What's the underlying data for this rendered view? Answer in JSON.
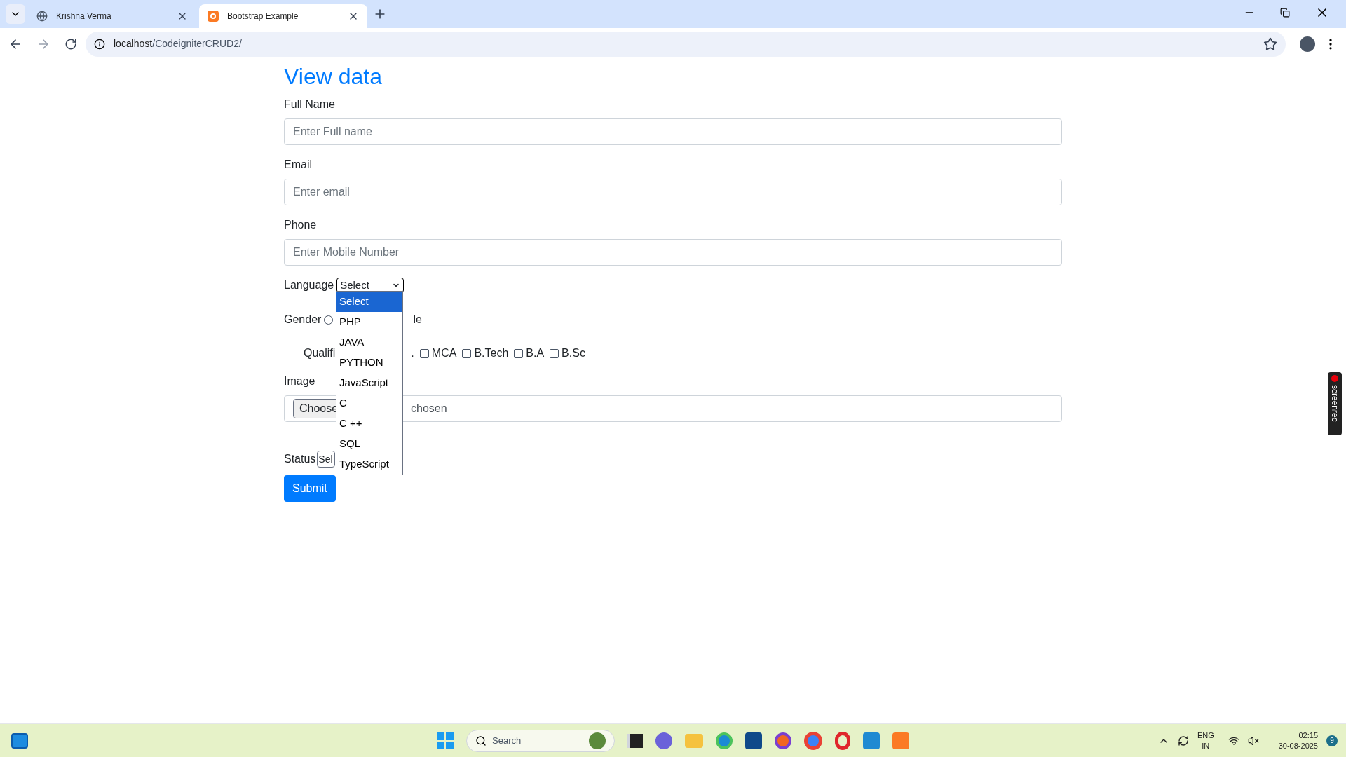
{
  "browser": {
    "tabs": [
      {
        "title": "Krishna Verma",
        "kind": "globe",
        "selected": false
      },
      {
        "title": "Bootstrap Example",
        "kind": "xampp",
        "selected": true
      }
    ],
    "url_host": "localhost",
    "url_path": "/CodeigniterCRUD2/"
  },
  "page": {
    "title": "View data",
    "fields": [
      {
        "label": "Full Name",
        "placeholder": "Enter Full name"
      },
      {
        "label": "Email",
        "placeholder": "Enter email"
      },
      {
        "label": "Phone",
        "placeholder": "Enter Mobile Number"
      }
    ],
    "language": {
      "label": "Language",
      "value": "Select",
      "expanded": true,
      "options": [
        {
          "label": "Select",
          "selected": true
        },
        {
          "label": "PHP",
          "selected": false
        },
        {
          "label": "JAVA",
          "selected": false
        },
        {
          "label": "PYTHON",
          "selected": false
        },
        {
          "label": "JavaScript",
          "selected": false
        },
        {
          "label": "C",
          "selected": false
        },
        {
          "label": "C ++",
          "selected": false
        },
        {
          "label": "SQL",
          "selected": false
        },
        {
          "label": "TypeScript",
          "selected": false
        }
      ]
    },
    "gender": {
      "label": "Gender",
      "checked": false,
      "trailing_text": "le"
    },
    "qualification": {
      "label": "Qualifi",
      "trailing_text": ".",
      "options": [
        {
          "label": "MCA",
          "checked": false
        },
        {
          "label": "B.Tech",
          "checked": false
        },
        {
          "label": "B.A",
          "checked": false
        },
        {
          "label": "B.Sc",
          "checked": false
        }
      ]
    },
    "image": {
      "label": "Image",
      "button": "Choose",
      "status": "chosen"
    },
    "status": {
      "label": "Status",
      "value": "Sel"
    },
    "submit": "Submit"
  },
  "screenrec": {
    "label": "screenrec"
  },
  "taskbar": {
    "search_placeholder": "Search",
    "language": "ENG",
    "region": "IN",
    "time": "02:15",
    "date": "30-08-2025",
    "notifications": "9"
  }
}
